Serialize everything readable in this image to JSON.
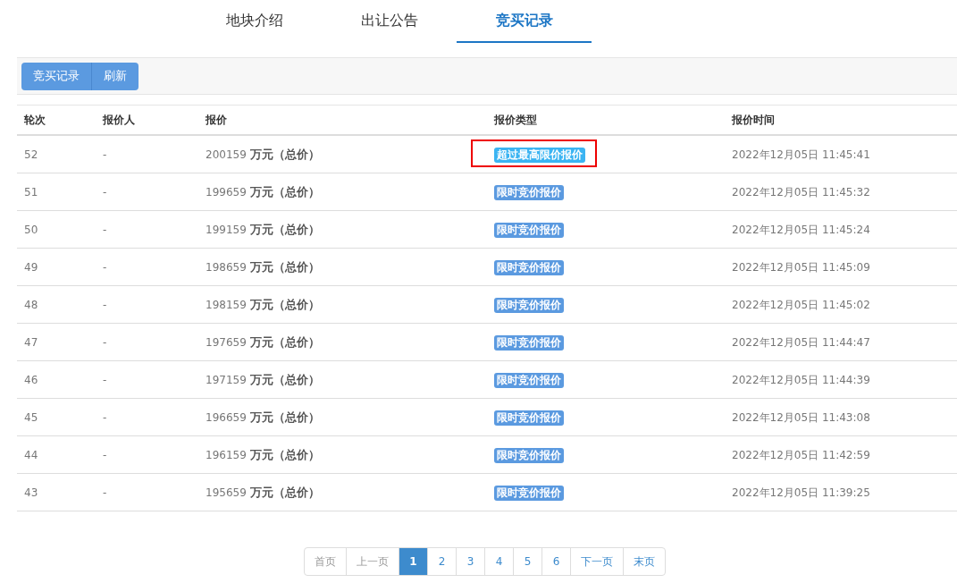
{
  "tabs": [
    {
      "label": "地块介绍",
      "selected": false
    },
    {
      "label": "出让公告",
      "selected": false
    },
    {
      "label": "竞买记录",
      "selected": true
    }
  ],
  "toolbar": {
    "buttons": [
      "竞买记录",
      "刷新"
    ]
  },
  "table": {
    "columns": [
      "轮次",
      "报价人",
      "报价",
      "报价类型",
      "报价时间"
    ],
    "rows": [
      {
        "round": "52",
        "bidder": "-",
        "amount": "200159",
        "unit": "万元（总价）",
        "type": {
          "kind": "over",
          "label": "超过最高限价报价"
        },
        "highlighted": true,
        "time": "2022年12月05日 11:45:41"
      },
      {
        "round": "51",
        "bidder": "-",
        "amount": "199659",
        "unit": "万元（总价）",
        "type": {
          "kind": "limit",
          "label": "限时竞价报价"
        },
        "highlighted": false,
        "time": "2022年12月05日 11:45:32"
      },
      {
        "round": "50",
        "bidder": "-",
        "amount": "199159",
        "unit": "万元（总价）",
        "type": {
          "kind": "limit",
          "label": "限时竞价报价"
        },
        "highlighted": false,
        "time": "2022年12月05日 11:45:24"
      },
      {
        "round": "49",
        "bidder": "-",
        "amount": "198659",
        "unit": "万元（总价）",
        "type": {
          "kind": "limit",
          "label": "限时竞价报价"
        },
        "highlighted": false,
        "time": "2022年12月05日 11:45:09"
      },
      {
        "round": "48",
        "bidder": "-",
        "amount": "198159",
        "unit": "万元（总价）",
        "type": {
          "kind": "limit",
          "label": "限时竞价报价"
        },
        "highlighted": false,
        "time": "2022年12月05日 11:45:02"
      },
      {
        "round": "47",
        "bidder": "-",
        "amount": "197659",
        "unit": "万元（总价）",
        "type": {
          "kind": "limit",
          "label": "限时竞价报价"
        },
        "highlighted": false,
        "time": "2022年12月05日 11:44:47"
      },
      {
        "round": "46",
        "bidder": "-",
        "amount": "197159",
        "unit": "万元（总价）",
        "type": {
          "kind": "limit",
          "label": "限时竞价报价"
        },
        "highlighted": false,
        "time": "2022年12月05日 11:44:39"
      },
      {
        "round": "45",
        "bidder": "-",
        "amount": "196659",
        "unit": "万元（总价）",
        "type": {
          "kind": "limit",
          "label": "限时竞价报价"
        },
        "highlighted": false,
        "time": "2022年12月05日 11:43:08"
      },
      {
        "round": "44",
        "bidder": "-",
        "amount": "196159",
        "unit": "万元（总价）",
        "type": {
          "kind": "limit",
          "label": "限时竞价报价"
        },
        "highlighted": false,
        "time": "2022年12月05日 11:42:59"
      },
      {
        "round": "43",
        "bidder": "-",
        "amount": "195659",
        "unit": "万元（总价）",
        "type": {
          "kind": "limit",
          "label": "限时竞价报价"
        },
        "highlighted": false,
        "time": "2022年12月05日 11:39:25"
      }
    ]
  },
  "pagination": [
    {
      "label": "首页",
      "selected": false,
      "disabled": true
    },
    {
      "label": "上一页",
      "selected": false,
      "disabled": true
    },
    {
      "label": "1",
      "selected": true,
      "disabled": false
    },
    {
      "label": "2",
      "selected": false,
      "disabled": false
    },
    {
      "label": "3",
      "selected": false,
      "disabled": false
    },
    {
      "label": "4",
      "selected": false,
      "disabled": false
    },
    {
      "label": "5",
      "selected": false,
      "disabled": false
    },
    {
      "label": "6",
      "selected": false,
      "disabled": false
    },
    {
      "label": "下一页",
      "selected": false,
      "disabled": false
    },
    {
      "label": "末页",
      "selected": false,
      "disabled": false
    }
  ]
}
